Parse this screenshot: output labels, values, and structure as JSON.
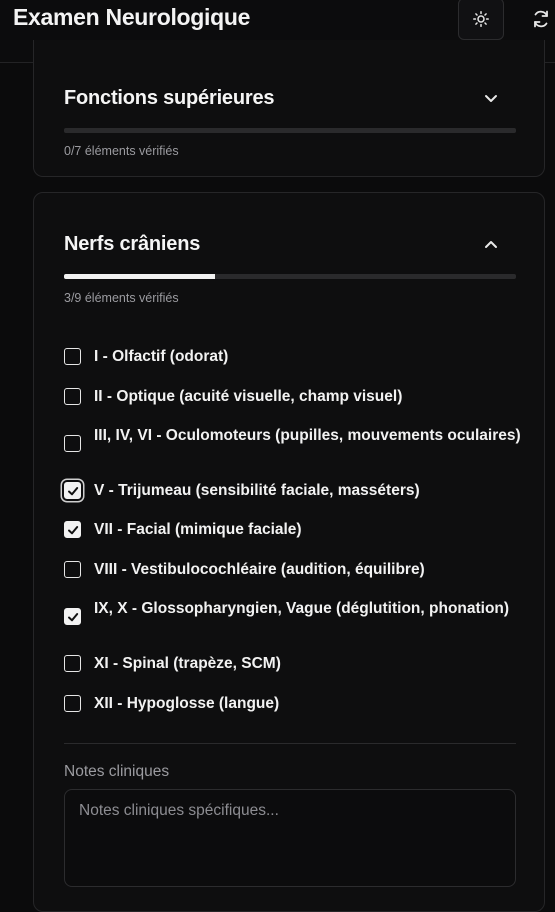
{
  "header": {
    "title": "Examen Neurologique",
    "theme_icon": "sun-icon",
    "refresh_icon": "refresh-icon"
  },
  "sections": [
    {
      "title": "Fonctions supérieures",
      "count_text": "0/7 éléments vérifiés",
      "progress": 0.0,
      "expanded": false
    },
    {
      "title": "Nerfs crâniens",
      "count_text": "3/9 éléments vérifiés",
      "progress": 0.333,
      "expanded": true,
      "items": [
        {
          "label": "I - Olfactif (odorat)",
          "checked": false
        },
        {
          "label": "II - Optique (acuité visuelle, champ visuel)",
          "checked": false
        },
        {
          "label": "III, IV, VI - Oculomoteurs (pupilles, mouvements oculaires)",
          "checked": false
        },
        {
          "label": "V - Trijumeau (sensibilité faciale, masséters)",
          "checked": true
        },
        {
          "label": "VII - Facial (mimique faciale)",
          "checked": true
        },
        {
          "label": "VIII - Vestibulocochléaire (audition, équilibre)",
          "checked": false
        },
        {
          "label": "IX, X - Glossopharyngien, Vague (déglutition, phonation)",
          "checked": true
        },
        {
          "label": "XI - Spinal (trapèze, SCM)",
          "checked": false
        },
        {
          "label": "XII - Hypoglosse (langue)",
          "checked": false
        }
      ],
      "notes_label": "Notes cliniques",
      "notes_placeholder": "Notes cliniques spécifiques...",
      "notes_value": ""
    }
  ]
}
